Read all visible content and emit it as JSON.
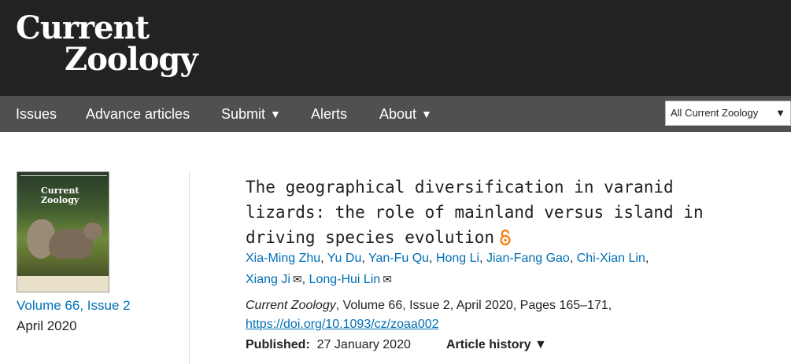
{
  "header": {
    "logo_line1": "Current",
    "logo_line2": "Zoology"
  },
  "nav": {
    "items": [
      {
        "label": "Issues",
        "caret": ""
      },
      {
        "label": "Advance articles",
        "caret": ""
      },
      {
        "label": "Submit",
        "caret": "▼"
      },
      {
        "label": "Alerts",
        "caret": ""
      },
      {
        "label": "About",
        "caret": "▼"
      }
    ],
    "search_scope": {
      "label": "All Current Zoology",
      "caret": "▼"
    }
  },
  "issue": {
    "cover_title_line1": "Current",
    "cover_title_line2": "Zoology",
    "link": "Volume 66, Issue 2",
    "date": "April 2020"
  },
  "article": {
    "title": "The geographical diversification in varanid lizards: the role of mainland versus island in driving species evolution",
    "authors": [
      {
        "name": "Xia-Ming Zhu",
        "sep": ", "
      },
      {
        "name": "Yu Du",
        "sep": ", "
      },
      {
        "name": "Yan-Fu Qu",
        "sep": ", "
      },
      {
        "name": "Hong Li",
        "sep": ", "
      },
      {
        "name": "Jian-Fang Gao",
        "sep": ", "
      },
      {
        "name": "Chi-Xian Lin",
        "sep": ","
      },
      {
        "name": "Xiang Ji",
        "sep": ", "
      },
      {
        "name": "Long-Hui Lin",
        "sep": ""
      }
    ],
    "mail_glyph": "✉",
    "citation_journal": "Current Zoology",
    "citation_rest": ", Volume 66, Issue 2, April 2020, Pages 165–171,",
    "doi": "https://doi.org/10.1093/cz/zoaa002",
    "published_label": "Published:",
    "published_date": "27 January 2020",
    "history_label": "Article history",
    "history_caret": "▼"
  },
  "colors": {
    "header_bg": "#222222",
    "nav_bg": "#505050",
    "link": "#006fb7",
    "open_access": "#f68212"
  },
  "icons": {
    "open_access": "open-access-icon",
    "mail": "envelope-icon",
    "dropdown": "caret-down-icon"
  }
}
